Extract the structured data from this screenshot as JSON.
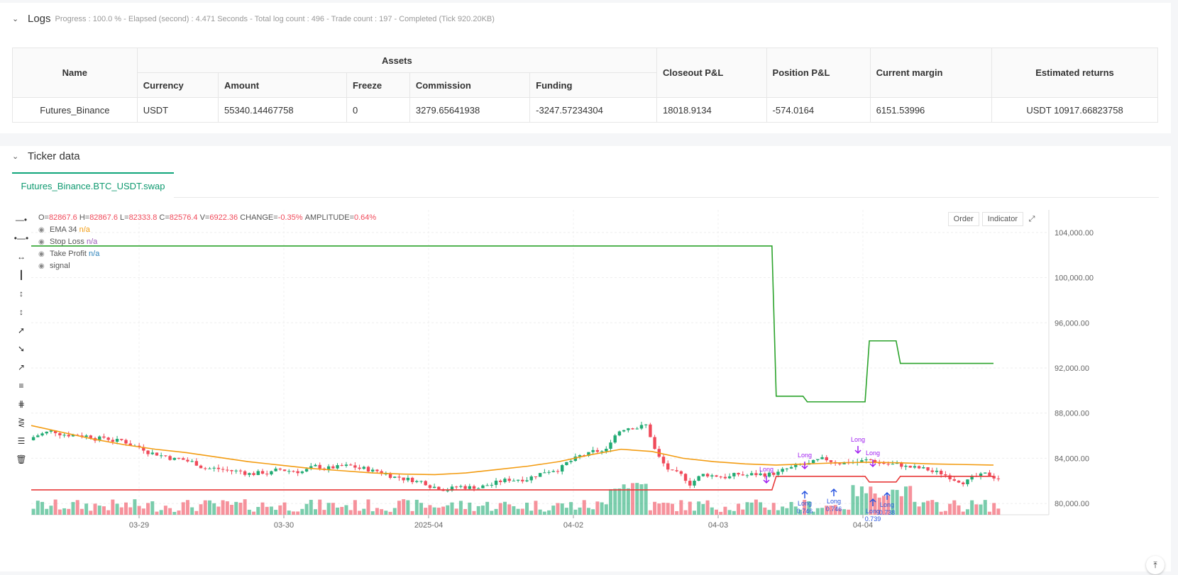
{
  "logs": {
    "title": "Logs",
    "subtitle": "Progress : 100.0 % - Elapsed (second) : 4.471  Seconds - Total log count : 496 - Trade count : 197 - Completed (Tick 920.20KB)",
    "table": {
      "col_name": "Name",
      "col_assets": "Assets",
      "col_currency": "Currency",
      "col_amount": "Amount",
      "col_freeze": "Freeze",
      "col_commission": "Commission",
      "col_funding": "Funding",
      "col_closeout": "Closeout P&L",
      "col_position": "Position P&L",
      "col_margin": "Current margin",
      "col_returns": "Estimated returns",
      "row": {
        "name": "Futures_Binance",
        "currency": "USDT",
        "amount": "55340.14467758",
        "freeze": "0",
        "commission": "3279.65641938",
        "funding": "-3247.57234304",
        "closeout": "18018.9134",
        "position": "-574.0164",
        "margin": "6151.53996",
        "returns": "USDT 10917.66823758"
      }
    }
  },
  "ticker": {
    "title": "Ticker data",
    "tab": "Futures_Binance.BTC_USDT.swap"
  },
  "chart": {
    "ohlc": {
      "o_label": "O=",
      "o": "82867.6",
      "h_label": "H=",
      "h": "82867.6",
      "l_label": "L=",
      "l": "82333.8",
      "c_label": "C=",
      "c": "82576.4",
      "v_label": "V=",
      "v": "6922.36",
      "change_label": "CHANGE=",
      "change": "-0.35%",
      "amp_label": "AMPLITUDE=",
      "amp": "0.64%"
    },
    "legend": [
      {
        "name": "EMA 34",
        "value": "n/a",
        "color": "#f39c12"
      },
      {
        "name": "Stop Loss",
        "value": "n/a",
        "color": "#9b59b6"
      },
      {
        "name": "Take Profit",
        "value": "n/a",
        "color": "#2980b9"
      },
      {
        "name": "signal",
        "value": "",
        "color": "#555555"
      }
    ],
    "buttons": {
      "order": "Order",
      "indicator": "Indicator"
    },
    "colors": {
      "up": "#22ab74",
      "down": "#f04a5a",
      "ema": "#f39c12",
      "stop": "#e83a3a",
      "take": "#2ba32b",
      "long": "#a020f0",
      "entry": "#2955e0"
    }
  },
  "chart_data": {
    "type": "candlestick",
    "x_ticks": [
      "03-29",
      "03-30",
      "2025-04",
      "04-02",
      "04-03",
      "04-04"
    ],
    "y_ticks": [
      "104,000.00",
      "100,000.00",
      "96,000.00",
      "92,000.00",
      "88,000.00",
      "84,000.00",
      "80,000.00"
    ],
    "ylim": [
      79000,
      106000
    ],
    "series": [
      {
        "name": "EMA 34",
        "values": [
          86900,
          86300,
          85700,
          85200,
          84800,
          84500,
          84100,
          83700,
          83400,
          83100,
          82900,
          82700,
          82600,
          82550,
          82700,
          83000,
          83300,
          83700,
          84300,
          84800,
          84600,
          84000,
          83700,
          83500,
          83400,
          83500,
          83600,
          83650,
          83600,
          83500,
          83450,
          83400
        ]
      },
      {
        "name": "Take Profit",
        "values": [
          102800,
          102800,
          102800,
          102800,
          102800,
          102800,
          102800,
          102800,
          102800,
          102800,
          102800,
          102800,
          102800,
          102800,
          102800,
          102800,
          102800,
          102800,
          102800,
          102800,
          102800,
          102800,
          102800,
          102800,
          89500,
          89000,
          89000,
          94400,
          92400,
          92400,
          92400,
          92400
        ]
      },
      {
        "name": "Stop Loss",
        "values": [
          81200,
          81200,
          81200,
          81200,
          81200,
          81200,
          81200,
          81200,
          81200,
          81200,
          81200,
          81200,
          81200,
          81200,
          81200,
          81200,
          81200,
          81200,
          81200,
          81200,
          81200,
          81200,
          81200,
          81200,
          82400,
          82400,
          82400,
          81900,
          82400,
          82400,
          82400,
          82400
        ]
      }
    ],
    "annotations": [
      "Long",
      "Long",
      "Long",
      "Long",
      "Long 0.746",
      "Long 0.746",
      "Long 0.739",
      "Long 0.738"
    ]
  }
}
